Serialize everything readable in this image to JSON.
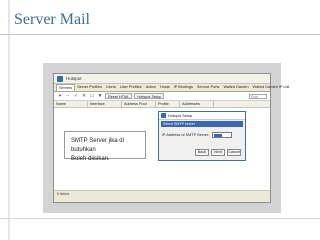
{
  "slide": {
    "title": "Server Mail"
  },
  "app": {
    "title": "Hotspot",
    "tabs": [
      "Servers",
      "Server Profiles",
      "Users",
      "User Profiles",
      "Active",
      "Hosts",
      "IP Bindings",
      "Service Ports",
      "Walled Garden",
      "Walled Garden IP List"
    ],
    "toolbar": {
      "reset_html": "Reset HTML",
      "hotspot_setup": "Hotspot Setup",
      "find": "Find"
    },
    "columns": [
      "Name",
      "Interface",
      "Address Pool",
      "Profile",
      "Addresses"
    ],
    "status": "0 items"
  },
  "note": {
    "line1": "SMTP Server jika di butuhkan",
    "line2": "Boleh diisikan."
  },
  "dialog": {
    "title": "Hotspot Setup",
    "step": "Select SMTP server",
    "label": "IP Address of SMTP Server:",
    "buttons": {
      "back": "Back",
      "next": "Next",
      "cancel": "Cancel"
    }
  }
}
